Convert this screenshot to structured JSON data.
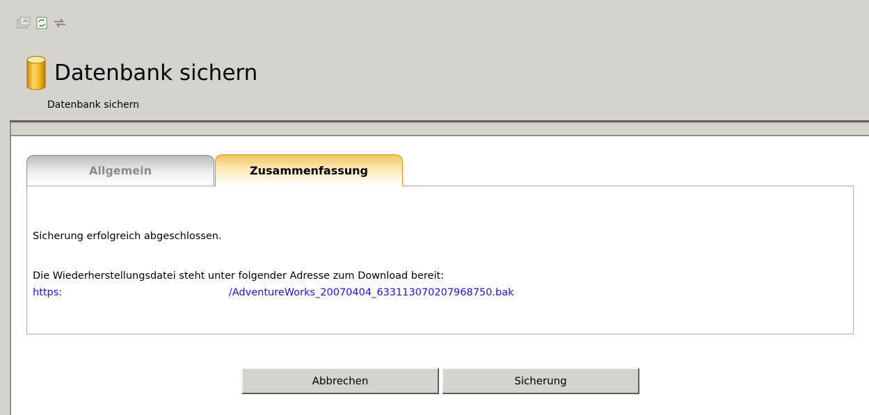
{
  "toolbar": {
    "icons": [
      "properties-icon",
      "refresh-icon",
      "sync-icon"
    ]
  },
  "page": {
    "title": "Datenbank sichern",
    "subtitle": "Datenbank sichern"
  },
  "tabs": [
    {
      "label": "Allgemein",
      "active": false
    },
    {
      "label": "Zusammenfassung",
      "active": true
    }
  ],
  "summary": {
    "status_message": "Sicherung erfolgreich abgeschlossen.",
    "download_info": "Die Wiederherstellungsdatei steht unter folgender Adresse zum Download bereit:",
    "download_link": "https:                                                    /AdventureWorks_20070404_633113070207968750.bak"
  },
  "buttons": {
    "cancel_label": "Abbrechen",
    "backup_label": "Sicherung"
  },
  "colors": {
    "background_gray": "#d6d3ce",
    "link_blue": "#1a14e6",
    "active_tab_gold": "#f0c25a"
  }
}
